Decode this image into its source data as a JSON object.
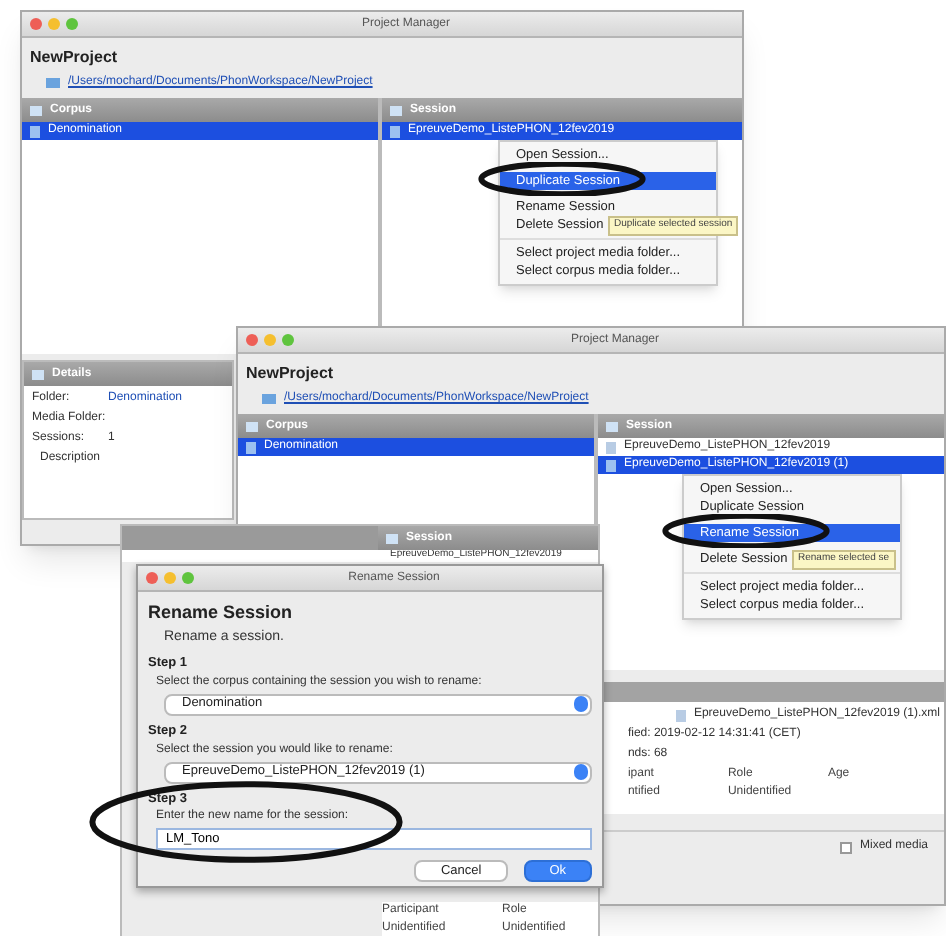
{
  "windows": [
    {
      "title": "Project Manager",
      "project": "NewProject",
      "path": "/Users/mochard/Documents/PhonWorkspace/NewProject",
      "corpus_header": "Corpus",
      "session_header": "Session",
      "corpora": [
        {
          "label": "Denomination",
          "selected": true
        }
      ],
      "sessions": [
        {
          "label": "EpreuveDemo_ListePHON_12fev2019",
          "selected": true
        }
      ],
      "menu": {
        "groups": [
          [
            {
              "label": "Open Session...",
              "selected": false
            },
            {
              "label": "Duplicate Session",
              "selected": true
            },
            {
              "label": "Rename Session",
              "selected": false
            },
            {
              "label": "Delete Session",
              "selected": false
            }
          ],
          [
            {
              "label": "Select project media folder...",
              "selected": false
            },
            {
              "label": "Select corpus media folder...",
              "selected": false
            }
          ]
        ],
        "tooltip": "Duplicate selected session"
      },
      "details": {
        "header": "Details",
        "rows": [
          {
            "label": "Folder:",
            "value": "Denomination"
          },
          {
            "label": "Media Folder:"
          },
          {
            "label": "Sessions:",
            "value": "1"
          },
          {
            "label": "Description"
          }
        ]
      }
    },
    {
      "title": "Project Manager",
      "project": "NewProject",
      "path": "/Users/mochard/Documents/PhonWorkspace/NewProject",
      "corpus_header": "Corpus",
      "session_header": "Session",
      "corpora": [
        {
          "label": "Denomination",
          "selected": true
        }
      ],
      "sessions": [
        {
          "label": "EpreuveDemo_ListePHON_12fev2019",
          "selected": false
        },
        {
          "label": "EpreuveDemo_ListePHON_12fev2019 (1)",
          "selected": true
        }
      ],
      "menu": {
        "groups": [
          [
            {
              "label": "Open Session...",
              "selected": false
            },
            {
              "label": "Duplicate Session",
              "selected": false
            },
            {
              "label": "Rename Session",
              "selected": true
            },
            {
              "label": "Delete Session",
              "selected": false
            }
          ],
          [
            {
              "label": "Select project media folder...",
              "selected": false
            },
            {
              "label": "Select corpus media folder...",
              "selected": false
            }
          ]
        ],
        "tooltip": "Rename selected se"
      },
      "session_info": {
        "file": "EpreuveDemo_ListePHON_12fev2019 (1).xml",
        "lines": [
          "fied: 2019-02-12 14:31:41 (CET)",
          "nds: 68"
        ],
        "columns": [
          "ipant",
          "Role",
          "Age"
        ],
        "row": [
          "ntified",
          "Unidentified"
        ]
      },
      "mixed_media": {
        "label": "Mixed media",
        "checked": false
      }
    }
  ],
  "background_window": {
    "session_header": "Session",
    "sessions": [
      "EpreuveDemo_ListePHON_12fev2019"
    ],
    "columns": [
      "Participant",
      "Role"
    ],
    "row": [
      "Unidentified",
      "Unidentified"
    ]
  },
  "dialog": {
    "title": "Rename Session",
    "heading": "Rename Session",
    "subtitle": "Rename a session.",
    "steps": [
      {
        "label": "Step 1",
        "prompt": "Select the corpus containing the session you wish to rename:",
        "kind": "select",
        "value": "Denomination"
      },
      {
        "label": "Step 2",
        "prompt": "Select the session you would like to rename:",
        "kind": "select",
        "value": "EpreuveDemo_ListePHON_12fev2019 (1)"
      },
      {
        "label": "Step 3",
        "prompt": "Enter the new name for the session:",
        "kind": "input",
        "value": "LM_Tono"
      }
    ],
    "buttons": [
      {
        "label": "Cancel",
        "primary": false
      },
      {
        "label": "Ok",
        "primary": true
      }
    ]
  }
}
